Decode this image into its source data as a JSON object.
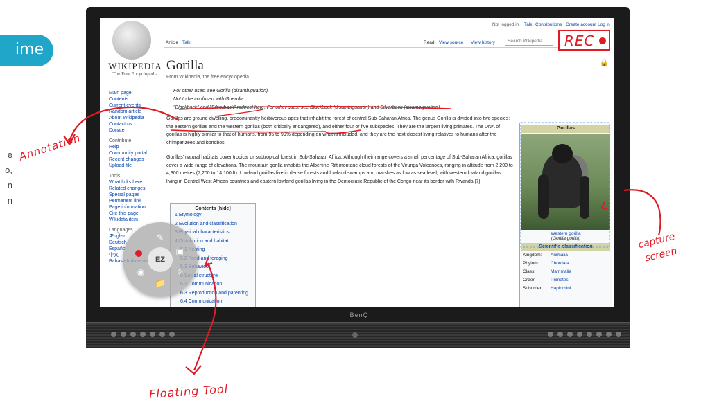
{
  "left_fragment": {
    "pill_text": "ime",
    "lines": [
      "e",
      "o,",
      "n",
      "n"
    ]
  },
  "monitor": {
    "brand": "BenQ",
    "colors": {
      "bezel": "#1b1b1b",
      "accent_red": "#e01b24"
    }
  },
  "wiki": {
    "logo_wordmark": "WIKIPEDIA",
    "logo_tagline": "The Free Encyclopedia",
    "personal_tools": [
      "Not logged in",
      "Talk",
      "Contributions",
      "Create account",
      "Log in"
    ],
    "tabs_left": [
      "Article",
      "Talk"
    ],
    "tabs_right": [
      "Read",
      "View source",
      "View history"
    ],
    "search_placeholder": "Search Wikipedia",
    "sidebar_main": [
      "Main page",
      "Contents",
      "Current events",
      "Random article",
      "About Wikipedia",
      "Contact us",
      "Donate"
    ],
    "sidebar_contribute_header": "Contribute",
    "sidebar_contribute": [
      "Help",
      "Community portal",
      "Recent changes",
      "Upload file"
    ],
    "sidebar_tools_header": "Tools",
    "sidebar_tools": [
      "What links here",
      "Related changes",
      "Special pages",
      "Permanent link",
      "Page information",
      "Cite this page",
      "Wikidata item"
    ],
    "sidebar_languages_header": "Languages",
    "sidebar_languages": [
      "Ænglisc",
      "Deutsch",
      "Español",
      "中文",
      "Bahasa Indonesia"
    ],
    "page_title": "Gorilla",
    "from_line": "From Wikipedia, the free encyclopedia",
    "hatnote_1": "For other uses, see Gorilla (disambiguation).",
    "hatnote_2": "Not to be confused with Guerrilla.",
    "hatnote_3": "\"Blackback\" and \"Silverback\" redirect here. For other uses, see Blackback (disambiguation) and Silverback (disambiguation).",
    "para_1": "Gorillas are ground-dwelling, predominantly herbivorous apes that inhabit the forest of central Sub-Saharan Africa. The genus Gorilla is divided into two species: the eastern gorillas and the western gorillas (both critically endangered), and either four or five subspecies. They are the largest living primates. The DNA of gorillas is highly similar to that of humans, from 95 to 99% depending on what is included, and they are the next closest living relatives to humans after the chimpanzees and bonobos.",
    "para_2": "Gorillas' natural habitats cover tropical or subtropical forest in Sub-Saharan Africa. Although their range covers a small percentage of Sub-Saharan Africa, gorillas cover a wide range of elevations. The mountain gorilla inhabits the Albertine Rift montane cloud forests of the Virunga Volcanoes, ranging in altitude from 2,200 to 4,300 metres (7,200 to 14,100 ft). Lowland gorillas live in dense forests and lowland swamps and marshes as low as sea level, with western lowland gorillas living in Central West African countries and eastern lowland gorillas living in the Democratic Republic of the Congo near its border with Rwanda.[7]",
    "toc_title": "Contents [hide]",
    "toc_items": [
      "1 Etymology",
      "2 Evolution and classification",
      "3 Physical characteristics",
      "4 Distribution and habitat",
      "5.1 Nesting",
      "5.2 Food and foraging",
      "5.3 Behaviour",
      "6 Social structure",
      "6.2 Communication",
      "6.3 Reproduction and parenting",
      "6.4 Communication"
    ],
    "infobox_title": "Gorillas",
    "infobox_caption": "Western gorilla",
    "infobox_caption2": "(Gorilla gorilla)",
    "infobox_section": "Scientific classification",
    "infobox_rows": [
      {
        "k": "Kingdom:",
        "v": "Animalia"
      },
      {
        "k": "Phylum:",
        "v": "Chordata"
      },
      {
        "k": "Class:",
        "v": "Mammalia"
      },
      {
        "k": "Order:",
        "v": "Primates"
      },
      {
        "k": "Suborder:",
        "v": "Haplorhini"
      }
    ]
  },
  "rec": {
    "label": "REC"
  },
  "floating_tool": {
    "center_label": "EZ"
  },
  "callouts": {
    "annotation": "Annotation",
    "capture_1": "capture",
    "capture_2": "screen",
    "floating": "Floating Tool"
  }
}
